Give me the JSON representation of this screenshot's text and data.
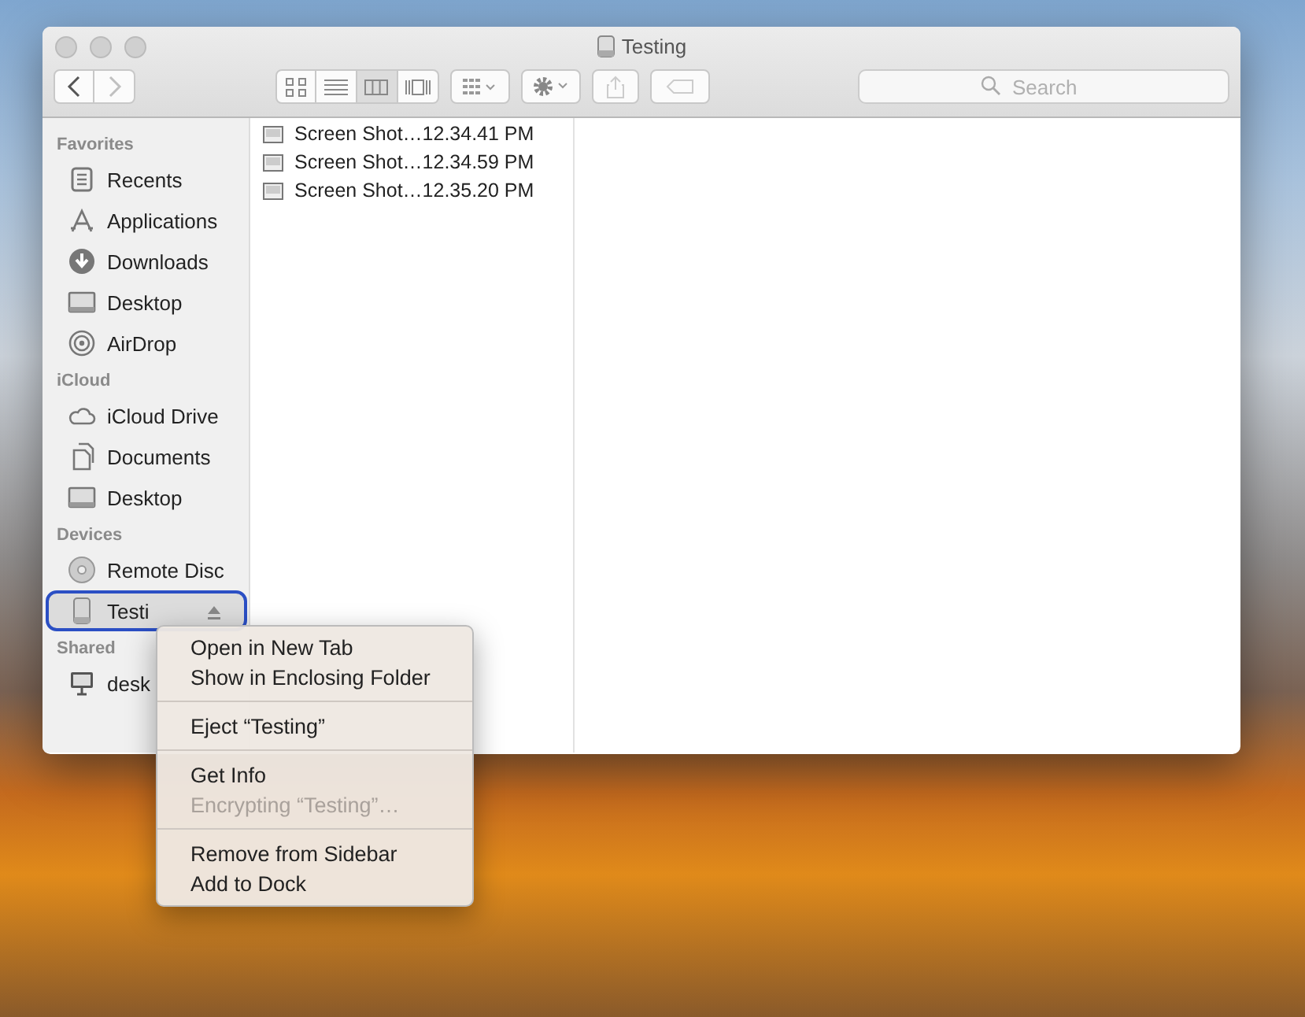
{
  "window": {
    "title": "Testing"
  },
  "toolbar": {
    "nav": [
      {
        "kind": "back",
        "disabled": false
      },
      {
        "kind": "forward",
        "disabled": true
      }
    ],
    "views": [
      {
        "kind": "icons",
        "selected": false
      },
      {
        "kind": "list",
        "selected": false
      },
      {
        "kind": "columns",
        "selected": true
      },
      {
        "kind": "gallery",
        "selected": false
      }
    ],
    "search": {
      "placeholder": "Search"
    }
  },
  "sidebar": {
    "sections": [
      {
        "title": "Favorites",
        "items": [
          {
            "label": "Recents",
            "kind": "recents",
            "selected": false
          },
          {
            "label": "Applications",
            "kind": "apps",
            "selected": false
          },
          {
            "label": "Downloads",
            "kind": "downloads",
            "selected": false
          },
          {
            "label": "Desktop",
            "kind": "desktop",
            "selected": false
          },
          {
            "label": "AirDrop",
            "kind": "airdrop",
            "selected": false
          }
        ]
      },
      {
        "title": "iCloud",
        "items": [
          {
            "label": "iCloud Drive",
            "kind": "cloud",
            "selected": false
          },
          {
            "label": "Documents",
            "kind": "docs",
            "selected": false
          },
          {
            "label": "Desktop",
            "kind": "desktop",
            "selected": false
          }
        ]
      },
      {
        "title": "Devices",
        "items": [
          {
            "label": "Remote Disc",
            "kind": "disc",
            "selected": false
          },
          {
            "label": "Testi",
            "kind": "drive",
            "selected": true
          }
        ]
      },
      {
        "title": "Shared",
        "items": [
          {
            "label": "desk",
            "kind": "computer",
            "selected": false
          }
        ]
      }
    ]
  },
  "files": [
    {
      "name": "Screen Shot…12.34.41 PM"
    },
    {
      "name": "Screen Shot…12.34.59 PM"
    },
    {
      "name": "Screen Shot…12.35.20 PM"
    }
  ],
  "context_menu": {
    "groups": [
      [
        {
          "label": "Open in New Tab",
          "disabled": false
        },
        {
          "label": "Show in Enclosing Folder",
          "disabled": false
        }
      ],
      [
        {
          "label": "Eject “Testing”",
          "disabled": false
        }
      ],
      [
        {
          "label": "Get Info",
          "disabled": false
        },
        {
          "label": "Encrypting “Testing”…",
          "disabled": true
        }
      ],
      [
        {
          "label": "Remove from Sidebar",
          "disabled": false
        },
        {
          "label": "Add to Dock",
          "disabled": false
        }
      ]
    ]
  }
}
